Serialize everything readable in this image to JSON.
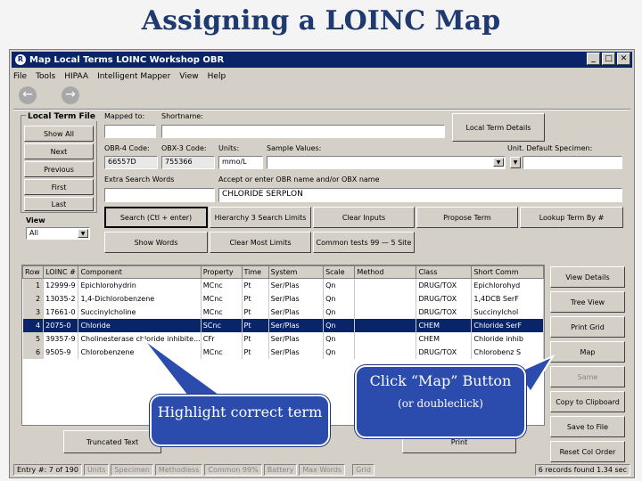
{
  "slide_title": "Assigning a LOINC Map",
  "window": {
    "title": "Map Local Terms  LOINC Workshop OBR",
    "app_icon": "R",
    "buttons": [
      "_",
      "□",
      "✕"
    ]
  },
  "menu": [
    "File",
    "Tools",
    "HIPAA",
    "Intelligent Mapper",
    "View",
    "Help"
  ],
  "nav": {
    "back": "←",
    "forward": "→"
  },
  "local_term_file": {
    "label": "Local Term File",
    "buttons": [
      "Show All",
      "Next",
      "Previous",
      "First",
      "Last"
    ]
  },
  "view": {
    "label": "View",
    "value": "All"
  },
  "fields": {
    "mapped_to_label": "Mapped to:",
    "shortname_label": "Shortname:",
    "obr4_label": "OBR-4 Code:",
    "obr4_value": "66557D",
    "obx3_label": "OBX-3 Code:",
    "obx3_value": "755366",
    "units_label": "Units:",
    "units_value": "mmo/L",
    "sample_values_label": "Sample Values:",
    "default_specimen_label": "Unit. Default Specimen:",
    "extra_search_label": "Extra Search Words",
    "accept_label": "Accept or enter OBR name and/or OBX name",
    "accept_value": "CHLORIDE SERPLON"
  },
  "buttons": {
    "local_term_details": "Local Term Details",
    "search": "Search (Ctl + enter)",
    "hierarchy_search": "Hierarchy 3 Search Limits",
    "clear_inputs": "Clear Inputs",
    "propose_term": "Propose Term",
    "lookup_term": "Lookup Term By #",
    "show_words": "Show Words",
    "clear_limits": "Clear Most Limits",
    "common_tests": "Common tests 99 — 5 Site",
    "truncated": "Truncated Text",
    "print": "Print"
  },
  "side_buttons": [
    "View Details",
    "Tree View",
    "Print Grid",
    "Map",
    "Same",
    "Copy to Clipboard",
    "Save to File",
    "Reset Col Order"
  ],
  "grid": {
    "columns": [
      "Row",
      "LOINC #",
      "Component",
      "Property",
      "Time",
      "System",
      "Scale",
      "Method",
      "Class",
      "Short Comm"
    ],
    "rows": [
      [
        "1",
        "12999-9",
        "Epichlorohydrin",
        "MCnc",
        "Pt",
        "Ser/Plas",
        "Qn",
        "",
        "DRUG/TOX",
        "Epichlorohyd"
      ],
      [
        "2",
        "13035-2",
        "1,4-Dichlorobenzene",
        "MCnc",
        "Pt",
        "Ser/Plas",
        "Qn",
        "",
        "DRUG/TOX",
        "1,4DCB SerF"
      ],
      [
        "3",
        "17661-0",
        "Succinylcholine",
        "MCnc",
        "Pt",
        "Ser/Plas",
        "Qn",
        "",
        "DRUG/TOX",
        "Succinylchol"
      ],
      [
        "4",
        "2075-0",
        "Chloride",
        "SCnc",
        "Pt",
        "Ser/Plas",
        "Qn",
        "",
        "CHEM",
        "Chloride SerF"
      ],
      [
        "5",
        "39357-9",
        "Cholinesterase chloride inhibite...",
        "CFr",
        "Pt",
        "Ser/Plas",
        "Qn",
        "",
        "CHEM",
        "Chloride inhib"
      ],
      [
        "6",
        "9505-9",
        "Chlorobenzene",
        "MCnc",
        "Pt",
        "Ser/Plas",
        "Qn",
        "",
        "DRUG/TOX",
        "Chlorobenz S"
      ]
    ],
    "selected_row": 4
  },
  "status": [
    "Entry #: 7 of 190",
    "Units",
    "Specimen",
    "Methodless",
    "Common 99%",
    "Battery",
    "Max Words",
    "Grid",
    "6 records found  1.34 sec"
  ],
  "callouts": {
    "highlight": "Highlight correct term",
    "map_title": "Click “Map” Button",
    "map_sub": "(or doubleclick)"
  },
  "colors": {
    "title": "#1f3a6e",
    "callout": "#2b4cad",
    "selection": "#0a246a"
  }
}
